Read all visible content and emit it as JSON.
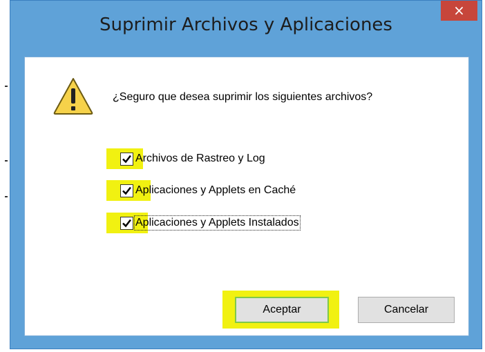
{
  "window": {
    "title": "Suprimir Archivos y Aplicaciones",
    "close_glyph": "×"
  },
  "dialog": {
    "icon": "warning-icon",
    "question": "¿Seguro que desea suprimir los siguientes archivos?",
    "options": [
      {
        "label": "Archivos de Rastreo y Log",
        "checked": true
      },
      {
        "label": "Aplicaciones y Applets en Caché",
        "checked": true
      },
      {
        "label": "Aplicaciones y Applets Instalados",
        "checked": true
      }
    ],
    "buttons": {
      "accept": "Aceptar",
      "cancel": "Cancelar"
    }
  },
  "colors": {
    "highlight": "#f1f111",
    "titlebar": "#5fa2d8",
    "close": "#c7463b"
  }
}
